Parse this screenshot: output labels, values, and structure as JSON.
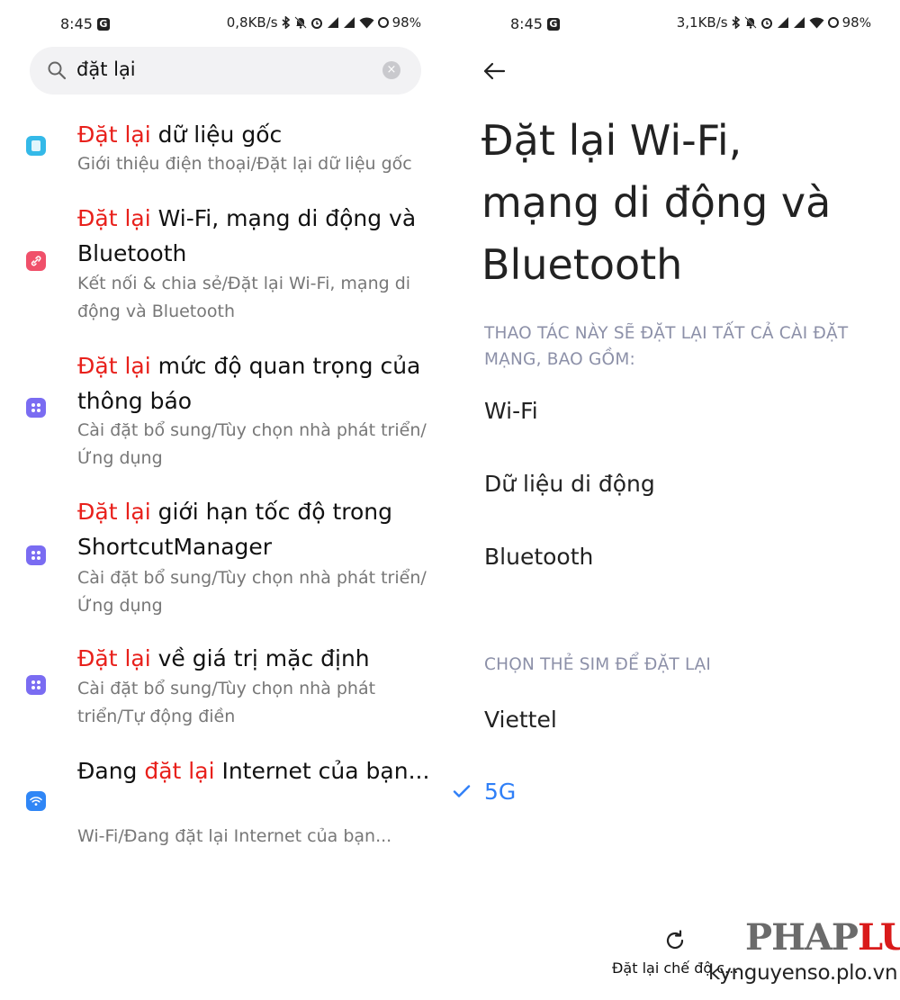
{
  "left": {
    "status": {
      "time": "8:45",
      "g_label": "G",
      "speed": "0,8KB/s",
      "battery": "98",
      "battery_unit": "%"
    },
    "search": {
      "value": "đặt lại",
      "clear_label": "×"
    },
    "results": [
      {
        "icon": "about-phone-icon",
        "color": "#34b9e8",
        "title_hl": "Đặt lại",
        "title_rest": " dữ liệu gốc",
        "sub": "Giới thiệu điện thoại/Đặt lại dữ liệu gốc"
      },
      {
        "icon": "connection-share-icon",
        "color": "#f0506a",
        "title_hl": "Đặt lại",
        "title_rest": " Wi-Fi, mạng di động và Bluetooth",
        "sub": "Kết nối & chia sẻ/Đặt lại Wi-Fi, mạng di động và Bluetooth"
      },
      {
        "icon": "additional-settings-icon",
        "color": "#7a6cf2",
        "title_hl": "Đặt lại",
        "title_rest": " mức độ quan trọng của thông báo",
        "sub": "Cài đặt bổ sung/Tùy chọn nhà phát triển/Ứng dụng"
      },
      {
        "icon": "additional-settings-icon",
        "color": "#7a6cf2",
        "title_hl": "Đặt lại",
        "title_rest": " giới hạn tốc độ trong ShortcutManager",
        "sub": "Cài đặt bổ sung/Tùy chọn nhà phát triển/Ứng dụng"
      },
      {
        "icon": "additional-settings-icon",
        "color": "#7a6cf2",
        "title_hl": "Đặt lại",
        "title_rest": " về giá trị mặc định",
        "sub": "Cài đặt bổ sung/Tùy chọn nhà phát triển/Tự động điền"
      },
      {
        "icon": "wifi-icon",
        "color": "#2f86f6",
        "title_pre": "Đang ",
        "title_hl": "đặt lại",
        "title_rest": " Internet của bạn...",
        "sub": "Wi-Fi/Đang đặt lại Internet của bạn..."
      }
    ]
  },
  "right": {
    "status": {
      "time": "8:45",
      "g_label": "G",
      "speed": "3,1KB/s",
      "battery": "98",
      "battery_unit": "%"
    },
    "title": "Đặt lại Wi-Fi, mạng di động và Bluetooth",
    "section_network": "THAO TÁC NÀY SẼ ĐẶT LẠI TẤT CẢ CÀI ĐẶT MẠNG, BAO GỒM:",
    "network_items": [
      "Wi-Fi",
      "Dữ liệu di động",
      "Bluetooth"
    ],
    "section_sim": "CHỌN THẺ SIM ĐỂ ĐẶT LẠI",
    "sim_options": [
      {
        "label": "Viettel",
        "selected": false
      },
      {
        "label": "5G",
        "selected": true
      }
    ],
    "bottom_action": "Đặt lại chế độ c...",
    "accent_color": "#2f7ff7"
  },
  "watermark": {
    "logo_main": "PHAP",
    "logo_accent": "LUAT",
    "url": "kynguyenso.plo.vn"
  }
}
